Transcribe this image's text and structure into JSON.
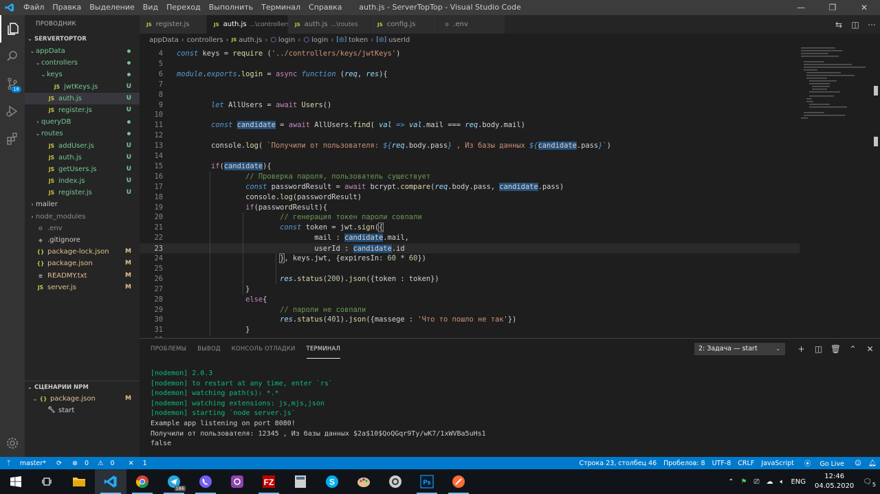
{
  "titlebar": {
    "menu": [
      "Файл",
      "Правка",
      "Выделение",
      "Вид",
      "Переход",
      "Выполнить",
      "Терминал",
      "Справка"
    ],
    "title": "auth.js - ServerTopTop - Visual Studio Code",
    "min": "—",
    "max": "❐",
    "close": "✕"
  },
  "activity": {
    "scm_badge": "18"
  },
  "sidebar": {
    "header": "ПРОВОДНИК",
    "project": "SERVERTOPTOR",
    "items": [
      {
        "label": "appData",
        "depth": 0,
        "type": "folder",
        "open": true,
        "status": "dot"
      },
      {
        "label": "controllers",
        "depth": 1,
        "type": "folder",
        "open": true,
        "status": "dot"
      },
      {
        "label": "keys",
        "depth": 2,
        "type": "folder",
        "open": true,
        "status": "dot"
      },
      {
        "label": "jwtKeys.js",
        "depth": 3,
        "type": "js",
        "status": "U"
      },
      {
        "label": "auth.js",
        "depth": 2,
        "type": "js",
        "status": "U",
        "selected": true
      },
      {
        "label": "register.js",
        "depth": 2,
        "type": "js",
        "status": "U"
      },
      {
        "label": "queryDB",
        "depth": 1,
        "type": "folder",
        "open": false,
        "status": "dot"
      },
      {
        "label": "routes",
        "depth": 1,
        "type": "folder",
        "open": true,
        "status": "dot"
      },
      {
        "label": "addUser.js",
        "depth": 2,
        "type": "js",
        "status": "U"
      },
      {
        "label": "auth.js",
        "depth": 2,
        "type": "js",
        "status": "U"
      },
      {
        "label": "getUsers.js",
        "depth": 2,
        "type": "js",
        "status": "U"
      },
      {
        "label": "index.js",
        "depth": 2,
        "type": "js",
        "status": "U"
      },
      {
        "label": "register.js",
        "depth": 2,
        "type": "js",
        "status": "U"
      },
      {
        "label": "mailer",
        "depth": 0,
        "type": "folder",
        "open": false,
        "status": ""
      },
      {
        "label": "node_modules",
        "depth": 0,
        "type": "folder",
        "open": false,
        "status": "",
        "ignored": true
      },
      {
        "label": ".env",
        "depth": 0,
        "type": "env",
        "status": "",
        "ignored": true
      },
      {
        "label": ".gitignore",
        "depth": 0,
        "type": "git",
        "status": ""
      },
      {
        "label": "package-lock.json",
        "depth": 0,
        "type": "json",
        "status": "M"
      },
      {
        "label": "package.json",
        "depth": 0,
        "type": "json",
        "status": "M"
      },
      {
        "label": "READMY.txt",
        "depth": 0,
        "type": "txt",
        "status": "M"
      },
      {
        "label": "server.js",
        "depth": 0,
        "type": "js",
        "status": "M"
      }
    ],
    "npm": {
      "header": "СЦЕНАРИИ NPM",
      "file": "package.json",
      "file_status": "M",
      "script": "start"
    }
  },
  "tabs": [
    {
      "label": "register.js",
      "sub": "",
      "active": false
    },
    {
      "label": "auth.js",
      "sub": "...\\controllers",
      "active": true
    },
    {
      "label": "auth.js",
      "sub": "...\\routes",
      "active": false
    },
    {
      "label": "config.js",
      "sub": "",
      "active": false
    },
    {
      "label": ".env",
      "sub": "",
      "active": false,
      "icon": "gear"
    }
  ],
  "breadcrumb": [
    "appData",
    "controllers",
    "auth.js",
    "login",
    "login",
    "token",
    "userId"
  ],
  "code_lines": [
    {
      "n": "4",
      "html": "<span class='kw'>const</span> <span class='pl'>keys</span> <span class='op'>=</span> <span class='fn'>require</span> <span class='pl'>(</span><span class='st'>'../controllers/keys/jwtKeys'</span><span class='pl'>)</span>"
    },
    {
      "n": "5",
      "html": ""
    },
    {
      "n": "6",
      "html": "<span class='kw'>module</span><span class='pl'>.</span><span class='kw'>exports</span><span class='pl'>.</span><span class='fn'>login</span> <span class='op'>=</span> <span class='kw2'>async</span> <span class='kw'>function</span> <span class='pl'>(</span><span class='vr'>req</span><span class='pl'>, </span><span class='vr'>res</span><span class='pl'>){</span>"
    },
    {
      "n": "7",
      "html": ""
    },
    {
      "n": "8",
      "html": ""
    },
    {
      "n": "9",
      "html": "        <span class='kw'>let</span> <span class='pl'>AllUsers</span> <span class='op'>=</span> <span class='kw2'>await</span> <span class='fn'>Users</span><span class='pl'>()</span>"
    },
    {
      "n": "10",
      "html": ""
    },
    {
      "n": "11",
      "html": "        <span class='kw'>const</span> <span class='pl hl'>candidate</span> <span class='op'>=</span> <span class='kw2'>await</span> <span class='pl'>AllUsers.</span><span class='fn'>find</span><span class='pl'>( </span><span class='vr'>val</span> <span class='kw'>=&gt;</span> <span class='vr'>val</span><span class='pl'>.mail </span><span class='op'>===</span> <span class='vr'>req</span><span class='pl'>.body.mail)</span>"
    },
    {
      "n": "12",
      "html": ""
    },
    {
      "n": "13",
      "html": "        <span class='pl'>console.</span><span class='fn'>log</span><span class='pl'>( </span><span class='st'>`Получили от пользователя: </span><span class='kw'>${</span><span class='vr'>req</span><span class='pl'>.body.pass</span><span class='kw'>}</span><span class='st'> , Из базы данных </span><span class='kw'>${</span><span class='pl hl'>candidate</span><span class='pl'>.pass</span><span class='kw'>}</span><span class='st'>`</span><span class='pl'>)</span>"
    },
    {
      "n": "14",
      "html": ""
    },
    {
      "n": "15",
      "html": "        <span class='kw2'>if</span><span class='pl'>(</span><span class='pl hl'>candidate</span><span class='pl'>){</span>"
    },
    {
      "n": "16",
      "html": "                <span class='ct'>// Проверка пароля, пользователь существует</span>"
    },
    {
      "n": "17",
      "html": "                <span class='kw'>const</span> <span class='pl'>passwordResult</span> <span class='op'>=</span> <span class='kw2'>await</span> <span class='pl'>bcrypt.</span><span class='fn'>compare</span><span class='pl'>(</span><span class='vr'>req</span><span class='pl'>.body.pass, </span><span class='pl hl'>candidate</span><span class='pl'>.pass)</span>"
    },
    {
      "n": "18",
      "html": "                <span class='pl'>console.</span><span class='fn'>log</span><span class='pl'>(passwordResult)</span>"
    },
    {
      "n": "19",
      "html": "                <span class='kw2'>if</span><span class='pl'>(passwordResult){</span>"
    },
    {
      "n": "20",
      "html": "                        <span class='ct'>// генерация токен пароли совпали</span>"
    },
    {
      "n": "21",
      "html": "                        <span class='kw'>const</span> <span class='pl'>token</span> <span class='op'>=</span> <span class='pl'>jwt.</span><span class='fn'>sign</span><span class='pl'>(</span><span class='pl' style='outline:1px solid #888'>{</span>"
    },
    {
      "n": "22",
      "html": "                                <span class='pl'>mail : </span><span class='pl hl'>candidate</span><span class='pl'>.mail,</span>"
    },
    {
      "n": "23",
      "html": "                                <span class='pl'>userId : </span><span class='pl hl'>candidate</span><span class='pl'>.id</span>",
      "current": true
    },
    {
      "n": "24",
      "html": "                        <span class='pl' style='outline:1px solid #888'>}</span><span class='pl'>, keys.jwt, {expiresIn: </span><span class='nm'>60</span> <span class='op'>*</span> <span class='nm'>60</span><span class='pl'>})</span>"
    },
    {
      "n": "25",
      "html": ""
    },
    {
      "n": "26",
      "html": "                        <span class='vr'>res</span><span class='pl'>.</span><span class='fn'>status</span><span class='pl'>(</span><span class='nm'>200</span><span class='pl'>).</span><span class='fn'>json</span><span class='pl'>({token : token})</span>"
    },
    {
      "n": "27",
      "html": "                <span class='pl'>}</span>"
    },
    {
      "n": "28",
      "html": "                <span class='kw2'>else</span><span class='pl'>{</span>"
    },
    {
      "n": "29",
      "html": "                        <span class='ct'>// пароли не совпали</span>"
    },
    {
      "n": "30",
      "html": "                        <span class='vr'>res</span><span class='pl'>.</span><span class='fn'>status</span><span class='pl'>(</span><span class='nm'>401</span><span class='pl'>).</span><span class='fn'>json</span><span class='pl'>({massege : </span><span class='st'>'Что то пошло не так'</span><span class='pl'>})</span>"
    },
    {
      "n": "31",
      "html": "                <span class='pl'>}</span>"
    },
    {
      "n": "32",
      "html": ""
    }
  ],
  "panel": {
    "tabs": [
      "ПРОБЛЕМЫ",
      "ВЫВОД",
      "КОНСОЛЬ ОТЛАДКИ",
      "ТЕРМИНАЛ"
    ],
    "active_tab": 3,
    "terminal_select": "2: Задача — start",
    "terminal_lines": [
      {
        "text": "[nodemon] 2.0.3",
        "green": true
      },
      {
        "text": "[nodemon] to restart at any time, enter `rs`",
        "green": true
      },
      {
        "text": "[nodemon] watching path(s): *.*",
        "green": true
      },
      {
        "text": "[nodemon] watching extensions: js,mjs,json",
        "green": true
      },
      {
        "text": "[nodemon] starting `node server.js`",
        "green": true
      },
      {
        "text": "Example app listening on port 8080!",
        "green": false
      },
      {
        "text": "Получили от пользователя: 12345 , Из базы данных $2a$10$QoQGqr9Ty/wK7/1xWVBa5uHs1",
        "green": false
      },
      {
        "text": "false",
        "green": false
      }
    ]
  },
  "statusbar": {
    "branch": "master*",
    "errors": "0",
    "warnings": "0",
    "ports": "1",
    "position": "Строка 23, столбец 46",
    "spaces": "Пробелов: 8",
    "encoding": "UTF-8",
    "eol": "CRLF",
    "language": "JavaScript",
    "golive": "Go Live"
  },
  "taskbar": {
    "telegram_badge": "186",
    "lang": "ENG",
    "time": "12:46",
    "date": "04.05.2020",
    "notif_count": "5"
  },
  "colors": {
    "accent": "#007acc",
    "git_untracked": "#73c991",
    "git_modified": "#e2c08d"
  }
}
